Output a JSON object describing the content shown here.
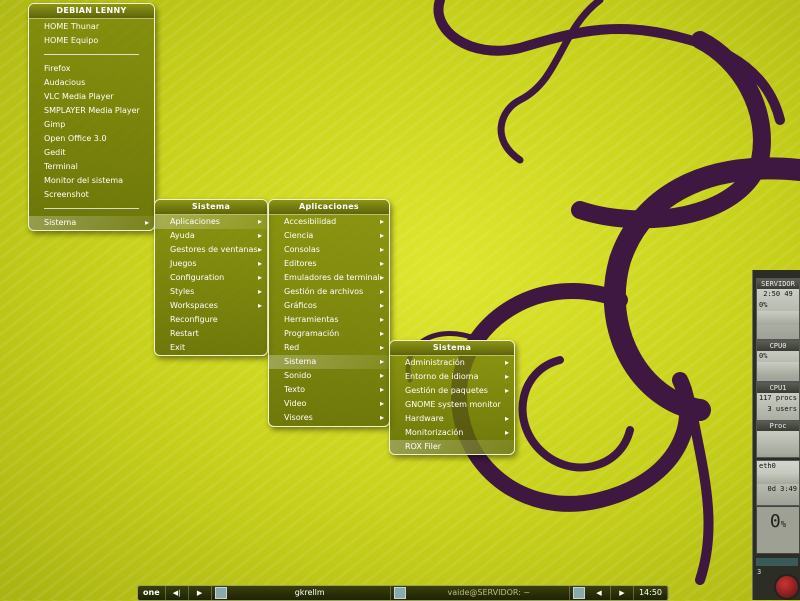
{
  "desktop": {
    "main_menu": {
      "title": "DEBIAN LENNY",
      "items_top": [
        "HOME Thunar",
        "HOME Equipo"
      ],
      "items_apps": [
        "Firefox",
        "Audacious",
        "VLC Media Player",
        "SMPLAYER Media Player",
        "Gimp",
        "Open Office 3.0",
        "Gedit",
        "Terminal",
        "Monitor del sistema",
        "Screenshot"
      ],
      "items_bottom": [
        "Sistema"
      ]
    },
    "sistema_menu": {
      "title": "Sistema",
      "items": [
        "Aplicaciones",
        "Ayuda",
        "Gestores de ventanas",
        "Juegos",
        "Configuration",
        "Styles",
        "Workspaces",
        "Reconfigure",
        "Restart",
        "Exit"
      ]
    },
    "aplicaciones_menu": {
      "title": "Aplicaciones",
      "items": [
        "Accesibilidad",
        "Ciencia",
        "Consolas",
        "Editores",
        "Emuladores de terminal",
        "Gestión de archivos",
        "Gráficos",
        "Herramientas",
        "Programación",
        "Red",
        "Sistema",
        "Sonido",
        "Texto",
        "Video",
        "Visores"
      ]
    },
    "sistema_sub_menu": {
      "title": "Sistema",
      "items": [
        "Administración",
        "Entorno de idioma",
        "Gestión de paquetes",
        "GNOME system monitor",
        "Hardware",
        "Monitorización",
        "ROX Filer"
      ]
    }
  },
  "taskbar": {
    "workspace": "one",
    "prev_icon": "prev-icon",
    "next_icon": "next-icon",
    "task_1": "gkrellm",
    "task_2": "vaide@SERVIDOR: ~",
    "clock": "14:50"
  },
  "gkrellm": {
    "host": "SERVIDOR",
    "time": "2:50",
    "time_sec": "49",
    "cpu_total": "0%",
    "cpu0_label": "CPU0",
    "cpu0_value": "0%",
    "cpu1_label": "CPU1",
    "procs": "117 procs",
    "users": "3 users",
    "proc_label": "Proc",
    "net_label": "eth0",
    "uptime": "0d 3:49",
    "disk_value": "0",
    "disk_unit": "%",
    "mem_label": "3"
  },
  "colors": {
    "background": "#d2da22",
    "swirl": "#3e1840",
    "menu_bg": "#6e780a",
    "menu_border": "#eef5c8"
  }
}
